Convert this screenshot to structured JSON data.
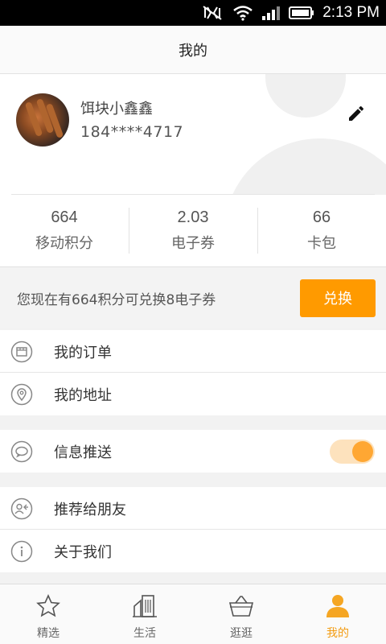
{
  "status_bar": {
    "time": "2:13 PM"
  },
  "header": {
    "title": "我的"
  },
  "profile": {
    "name": "饵块小鑫鑫",
    "phone": "184****4717"
  },
  "stats": [
    {
      "value": "664",
      "label": "移动积分"
    },
    {
      "value": "2.03",
      "label": "电子券"
    },
    {
      "value": "66",
      "label": "卡包"
    }
  ],
  "exchange": {
    "message": "您现在有664积分可兑换8电子券",
    "button_label": "兑换"
  },
  "menu": {
    "orders": "我的订单",
    "address": "我的地址",
    "push": "信息推送",
    "recommend": "推荐给朋友",
    "about": "关于我们"
  },
  "push_enabled": true,
  "tabs": [
    {
      "label": "精选"
    },
    {
      "label": "生活"
    },
    {
      "label": "逛逛"
    },
    {
      "label": "我的"
    }
  ],
  "colors": {
    "accent": "#ff9a00",
    "toggle_track": "#fde2bd",
    "toggle_knob": "#ffa733"
  }
}
